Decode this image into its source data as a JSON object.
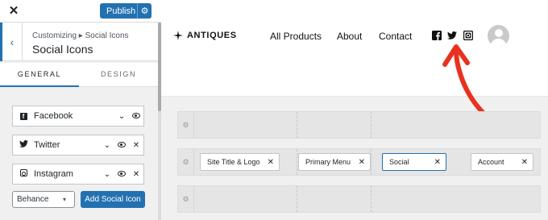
{
  "topbar": {
    "close_glyph": "✕",
    "publish_label": "Publish",
    "settings_glyph": "⚙"
  },
  "section": {
    "breadcrumb": "Customizing ▸ Social Icons",
    "title": "Social Icons",
    "back_glyph": "‹"
  },
  "tabs": [
    {
      "label": "GENERAL",
      "active": true
    },
    {
      "label": "DESIGN",
      "active": false
    }
  ],
  "social_items": [
    {
      "name": "Facebook",
      "icon": "facebook-icon",
      "controls": [
        "chevron",
        "eye"
      ]
    },
    {
      "name": "Twitter",
      "icon": "twitter-icon",
      "controls": [
        "chevron",
        "eye",
        "x"
      ]
    },
    {
      "name": "Instagram",
      "icon": "instagram-icon",
      "controls": [
        "chevron",
        "eye",
        "x"
      ]
    }
  ],
  "add_row": {
    "select_value": "Behance",
    "add_button_label": "Add Social Icon"
  },
  "site": {
    "logo_text": "ANTIQUES",
    "nav": [
      "All Products",
      "About",
      "Contact"
    ],
    "social_icons": [
      "facebook-icon",
      "twitter-icon",
      "instagram-icon"
    ]
  },
  "builder": {
    "middle_row_items": [
      {
        "label": "Site Title & Logo",
        "selected": false
      },
      {
        "label": "Primary Menu",
        "selected": false
      },
      {
        "label": "Social",
        "selected": true
      },
      {
        "label": "Account",
        "selected": false
      }
    ],
    "remove_glyph": "✕"
  },
  "colors": {
    "accent": "#2271b1",
    "annotation_arrow": "#e8321f"
  }
}
